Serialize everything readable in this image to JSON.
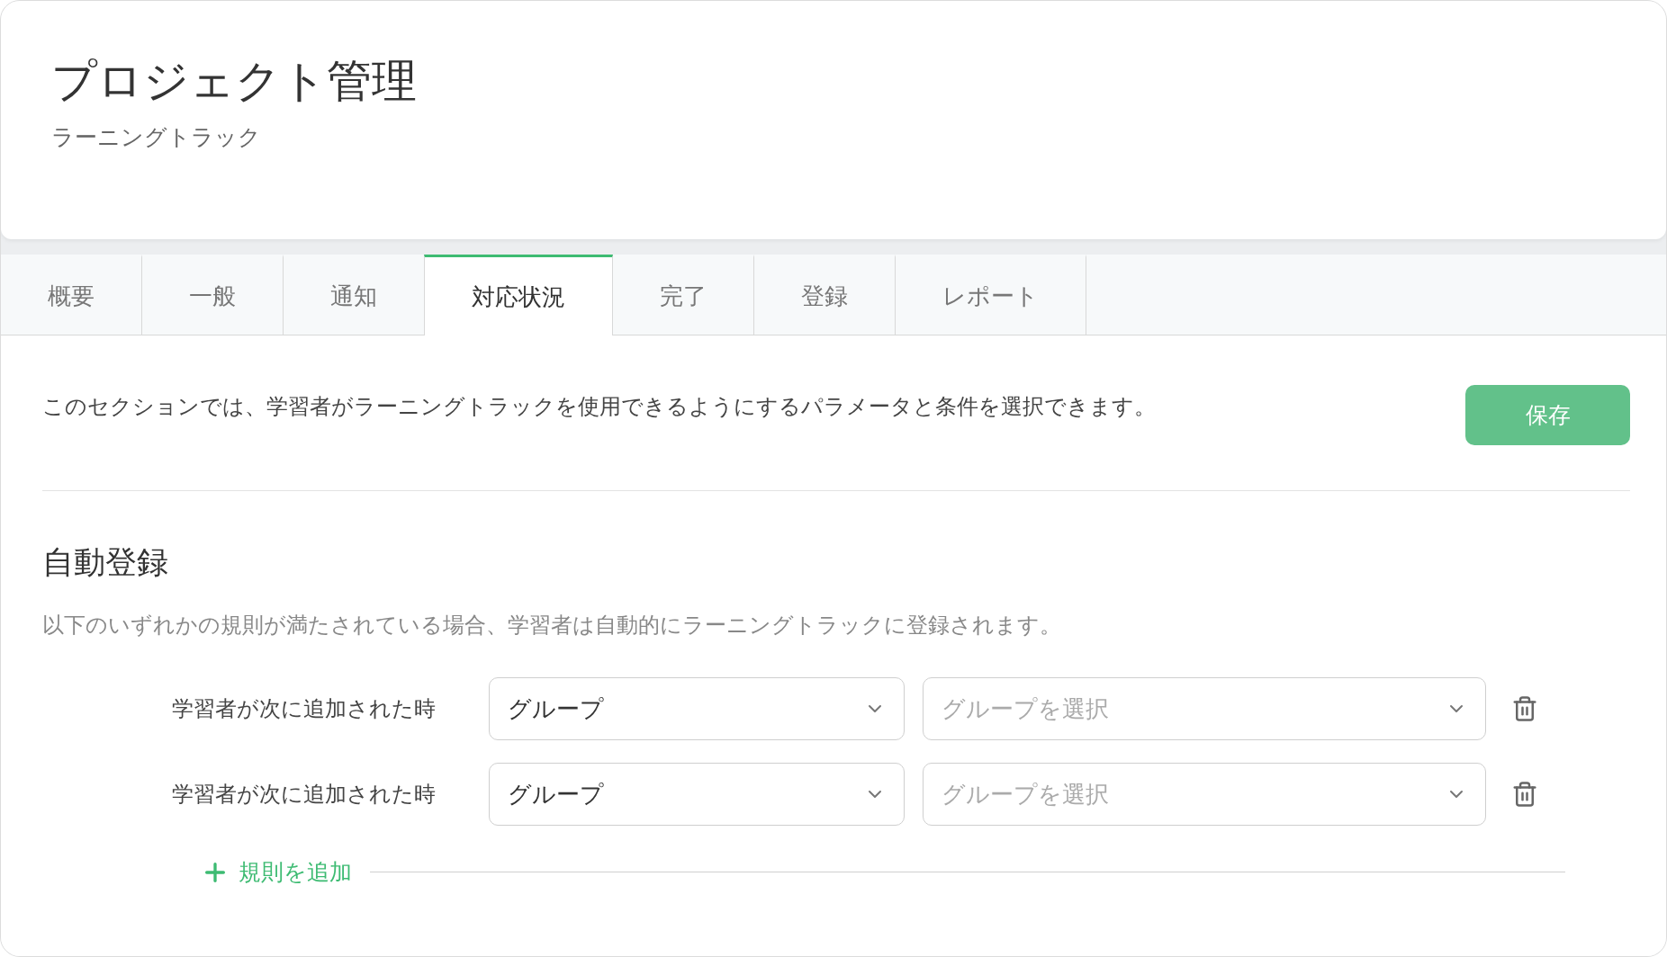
{
  "header": {
    "title": "プロジェクト管理",
    "subtitle": "ラーニングトラック"
  },
  "tabs": [
    {
      "label": "概要",
      "selected": false
    },
    {
      "label": "一般",
      "selected": false
    },
    {
      "label": "通知",
      "selected": false
    },
    {
      "label": "対応状況",
      "selected": true
    },
    {
      "label": "完了",
      "selected": false
    },
    {
      "label": "登録",
      "selected": false
    },
    {
      "label": "レポート",
      "selected": false
    }
  ],
  "intro": {
    "text": "このセクションでは、学習者がラーニングトラックを使用できるようにするパラメータと条件を選択できます。",
    "save_button": "保存"
  },
  "auto_enrollment": {
    "heading": "自動登録",
    "description": "以下のいずれかの規則が満たされている場合、学習者は自動的にラーニングトラックに登録されます。",
    "rules": [
      {
        "label": "学習者が次に追加された時",
        "type": "グループ",
        "placeholder": "グループを選択"
      },
      {
        "label": "学習者が次に追加された時",
        "type": "グループ",
        "placeholder": "グループを選択"
      }
    ],
    "add_rule": "規則を追加"
  }
}
